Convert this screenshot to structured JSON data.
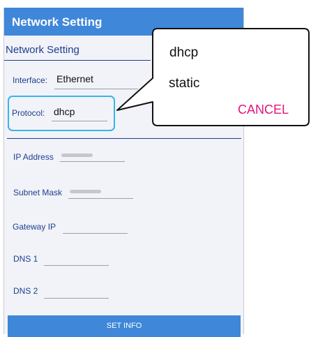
{
  "app_bar": {
    "title": "Network Setting"
  },
  "section": {
    "title": "Network Setting"
  },
  "interface": {
    "label": "Interface:",
    "value": "Ethernet"
  },
  "protocol": {
    "label": "Protocol:",
    "value": "dhcp"
  },
  "ip_address": {
    "label": "IP Address"
  },
  "subnet_mask": {
    "label": "Subnet Mask"
  },
  "gateway_ip": {
    "label": "Gateway IP"
  },
  "dns1": {
    "label": "DNS 1"
  },
  "dns2": {
    "label": "DNS 2"
  },
  "set_info": {
    "label": "SET INFO"
  },
  "dropdown": {
    "options": [
      "dhcp",
      "static"
    ],
    "cancel_label": "CANCEL"
  },
  "colors": {
    "app_bar": "#3f87d8",
    "label_text": "#1d3e8f",
    "highlight_border": "#39b4e8",
    "cancel_text": "#e3147b"
  }
}
